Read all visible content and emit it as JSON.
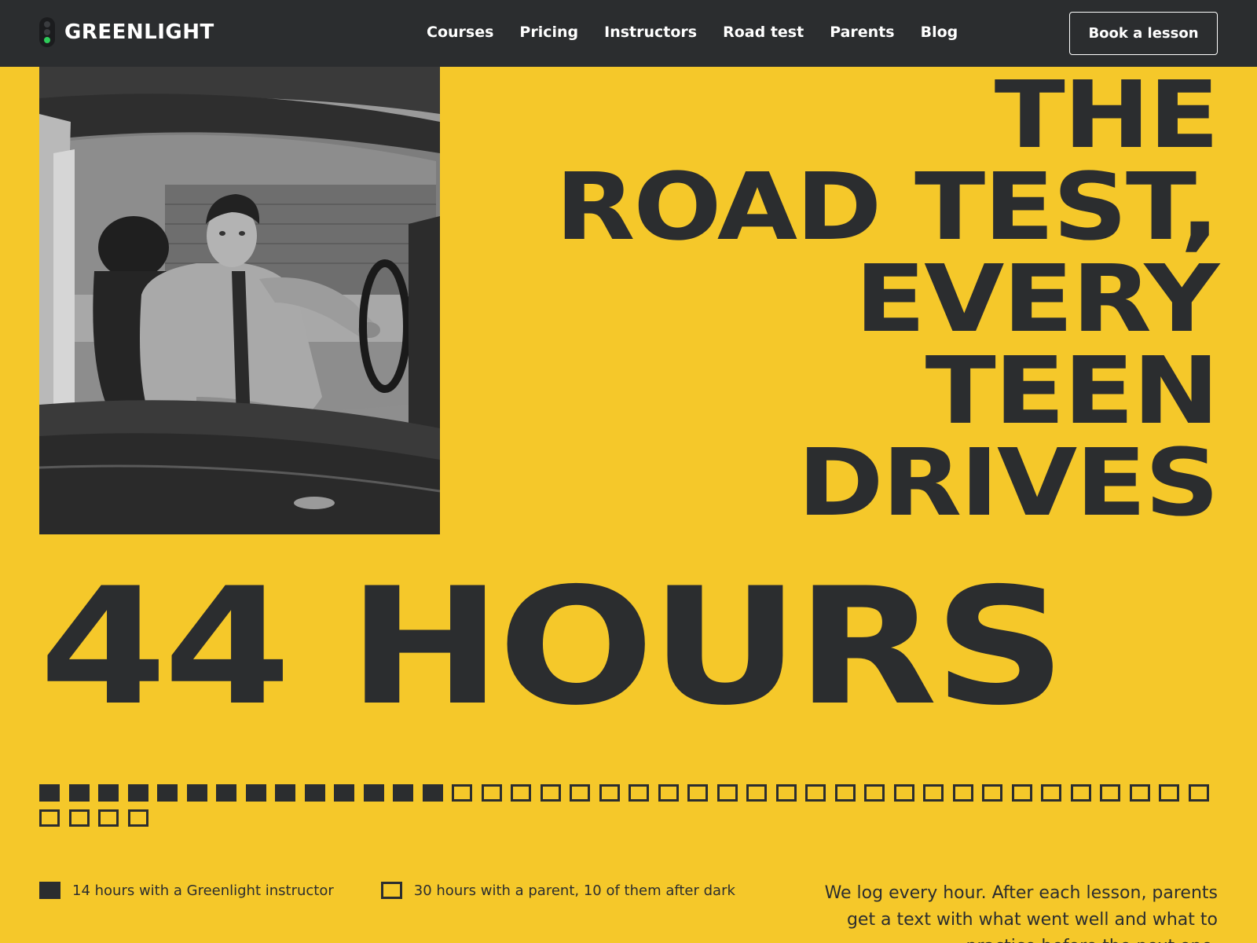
{
  "brand": {
    "name": "GREENLIGHT",
    "logo_icon": "traffic-light-icon"
  },
  "nav": {
    "links": [
      "Courses",
      "Pricing",
      "Instructors",
      "Road test",
      "Parents",
      "Blog"
    ],
    "cta": "Book a lesson"
  },
  "hero": {
    "headline": [
      "THE",
      "ROAD TEST,",
      "EVERY",
      "TEEN",
      "DRIVES"
    ],
    "photo_alt": "teen-driver-in-car-photo"
  },
  "stat": {
    "big": "44 HOURS",
    "total_hours": 44,
    "instructor_hours": 14
  },
  "legend": {
    "instructor": "14 hours with a Greenlight instructor",
    "parent": "30 hours with a parent, 10 of them after dark"
  },
  "body_copy": "We log every hour. After each lesson, parents get a text with what went well and what to practice before the next one.",
  "colors": {
    "background": "#f5c82a",
    "dark": "#2b2d2f",
    "green": "#2ecc5a",
    "white": "#ffffff"
  }
}
